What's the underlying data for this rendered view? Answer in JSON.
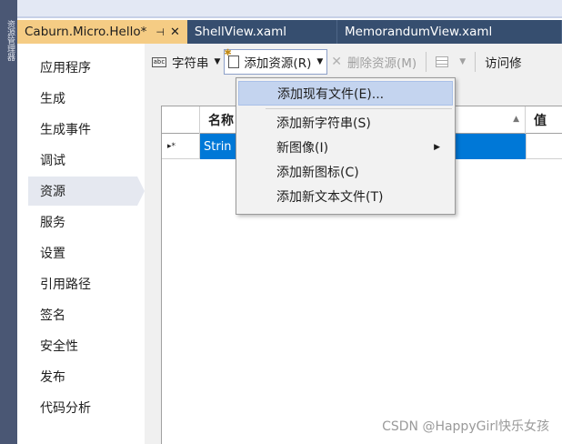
{
  "side_strip": {
    "label": "资源管理器"
  },
  "tabs": [
    {
      "label": "Caburn.Micro.Hello*",
      "pin_icon": "pin-icon",
      "close_icon": "close-icon"
    },
    {
      "label": "ShellView.xaml"
    },
    {
      "label": "MemorandumView.xaml"
    }
  ],
  "left_nav": {
    "items": [
      {
        "label": "应用程序"
      },
      {
        "label": "生成"
      },
      {
        "label": "生成事件"
      },
      {
        "label": "调试"
      },
      {
        "label": "资源"
      },
      {
        "label": "服务"
      },
      {
        "label": "设置"
      },
      {
        "label": "引用路径"
      },
      {
        "label": "签名"
      },
      {
        "label": "安全性"
      },
      {
        "label": "发布"
      },
      {
        "label": "代码分析"
      }
    ],
    "selected": "资源"
  },
  "toolbar": {
    "strings_label": "字符串",
    "add_resource_label": "添加资源(R)",
    "remove_resource_label": "删除资源(M)",
    "access_label": "访问修"
  },
  "grid": {
    "columns": [
      "名称",
      "值"
    ],
    "row_marker": "▸*",
    "rows": [
      {
        "name": "Strin"
      }
    ]
  },
  "menu": {
    "items": [
      {
        "label": "添加现有文件(E)...",
        "highlighted": true
      },
      {
        "label": "添加新字符串(S)"
      },
      {
        "label": "新图像(I)",
        "has_submenu": true
      },
      {
        "label": "添加新图标(C)"
      },
      {
        "label": "添加新文本文件(T)"
      }
    ]
  },
  "watermark": "CSDN @HappyGirl快乐女孩",
  "colors": {
    "active_tab": "#f5cc84",
    "tab_bar": "#364e6f",
    "selection": "#0078d7",
    "menu_highlight": "#c4d4ef"
  }
}
